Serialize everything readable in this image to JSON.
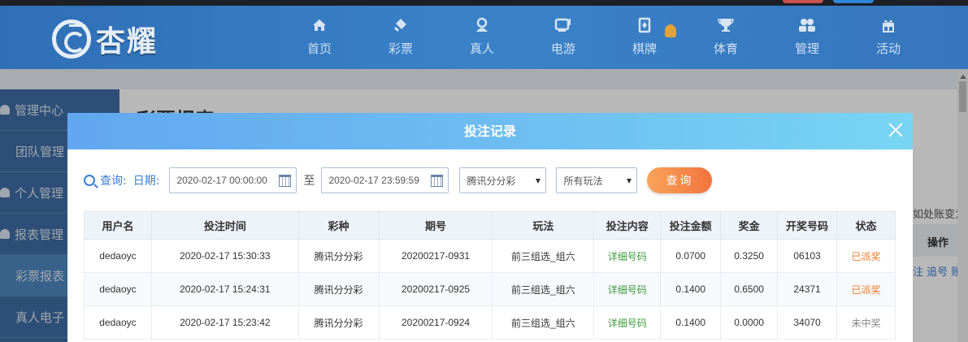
{
  "header": {
    "logo_text": "杏耀",
    "nav": [
      {
        "label": "首页",
        "icon": "home-icon"
      },
      {
        "label": "彩票",
        "icon": "ticket-icon"
      },
      {
        "label": "真人",
        "icon": "person-icon"
      },
      {
        "label": "电游",
        "icon": "gamepad-icon"
      },
      {
        "label": "棋牌",
        "icon": "cards-icon"
      },
      {
        "label": "体育",
        "icon": "trophy-icon"
      },
      {
        "label": "管理",
        "icon": "users-icon"
      },
      {
        "label": "活动",
        "icon": "gift-icon"
      }
    ]
  },
  "sidebar": {
    "items": [
      {
        "label": "管理中心"
      },
      {
        "label": "团队管理"
      },
      {
        "label": "个人管理"
      },
      {
        "label": "报表管理"
      },
      {
        "label": "彩票报表"
      },
      {
        "label": "真人电子"
      }
    ]
  },
  "background": {
    "page_title": "彩票报表",
    "right_note": "如处账变为",
    "right_head": "操作",
    "right_links": "注 追号 账"
  },
  "modal": {
    "title": "投注记录",
    "filter": {
      "query_label": "查询:",
      "date_label": "日期:",
      "start_date": "2020-02-17 00:00:00",
      "to_label": "至",
      "end_date": "2020-02-17 23:59:59",
      "lottery_select": "腾讯分分彩",
      "play_select": "所有玩法",
      "query_button": "查询"
    },
    "table": {
      "columns": [
        "用户名",
        "投注时间",
        "彩种",
        "期号",
        "玩法",
        "投注内容",
        "投注金额",
        "奖金",
        "开奖号码",
        "状态"
      ],
      "rows": [
        [
          "dedaoyc",
          "2020-02-17 15:30:33",
          "腾讯分分彩",
          "20200217-0931",
          "前三组选_组六",
          "详细号码",
          "0.0700",
          "0.3250",
          "06103",
          "已派奖"
        ],
        [
          "dedaoyc",
          "2020-02-17 15:24:31",
          "腾讯分分彩",
          "20200217-0925",
          "前三组选_组六",
          "详细号码",
          "0.1400",
          "0.6500",
          "24371",
          "已派奖"
        ],
        [
          "dedaoyc",
          "2020-02-17 15:23:42",
          "腾讯分分彩",
          "20200217-0924",
          "前三组选_组六",
          "详细号码",
          "0.1400",
          "0.0000",
          "34070",
          "未中奖"
        ]
      ]
    }
  },
  "colors": {
    "accent": "#3a7ed0",
    "status_paid": "#f07b2b",
    "status_lost": "#888888",
    "detail_link": "#3d9b3d"
  }
}
